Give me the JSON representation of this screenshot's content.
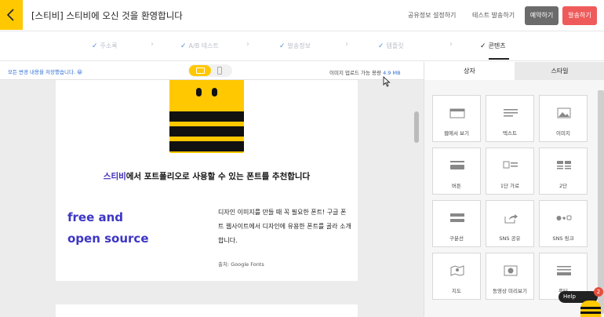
{
  "header": {
    "title": "[스티비] 스티비에 오신 것을 환영합니다",
    "share_settings": "공유정보 설정하기",
    "test_send": "테스트 발송하기",
    "schedule": "예약하기",
    "send": "발송하기",
    "colors": {
      "back": "#ffc800",
      "schedule": "#6b6b6b",
      "send": "#ef5b5b"
    }
  },
  "steps": [
    {
      "label": "주소록"
    },
    {
      "label": "A/B 테스트"
    },
    {
      "label": "발송정보"
    },
    {
      "label": "템플릿"
    },
    {
      "label": "콘텐츠"
    }
  ],
  "subbar": {
    "autosave": "모든 변경 내용을 저장했습니다.",
    "autosave_emoji": "😀",
    "quota_label": "이미지 업로드 가능 용량",
    "quota_value": "4.9 MB"
  },
  "content": {
    "headline_highlight": "스티비",
    "headline_rest": "에서 포트폴리오로 사용할 수 있는 폰트를 추천합니다",
    "fos_line1": "free and",
    "fos_line2": "open source",
    "description": "디자인 이미지를 만들 때 꼭 필요한 폰트! 구글 폰트 웹사이트에서 디자인에 유용한 폰트를 골라 소개합니다.",
    "source": "출처: Google Fonts"
  },
  "panel": {
    "tab_blocks": "상자",
    "tab_style": "스타일",
    "blocks": [
      {
        "label": "웹에서 보기",
        "icon": "webview-icon"
      },
      {
        "label": "텍스트",
        "icon": "text-icon"
      },
      {
        "label": "이미지",
        "icon": "image-icon"
      },
      {
        "label": "버튼",
        "icon": "button-icon"
      },
      {
        "label": "1단 가로",
        "icon": "image-text-icon"
      },
      {
        "label": "2단",
        "icon": "two-column-icon"
      },
      {
        "label": "구분선",
        "icon": "divider-icon"
      },
      {
        "label": "SNS 공유",
        "icon": "share-icon"
      },
      {
        "label": "SNS 링크",
        "icon": "sns-link-icon"
      },
      {
        "label": "지도",
        "icon": "map-icon"
      },
      {
        "label": "동영상 미리보기",
        "icon": "video-icon"
      },
      {
        "label": "푸터",
        "icon": "footer-icon"
      }
    ]
  },
  "help": {
    "label": "Help",
    "count": "2"
  }
}
